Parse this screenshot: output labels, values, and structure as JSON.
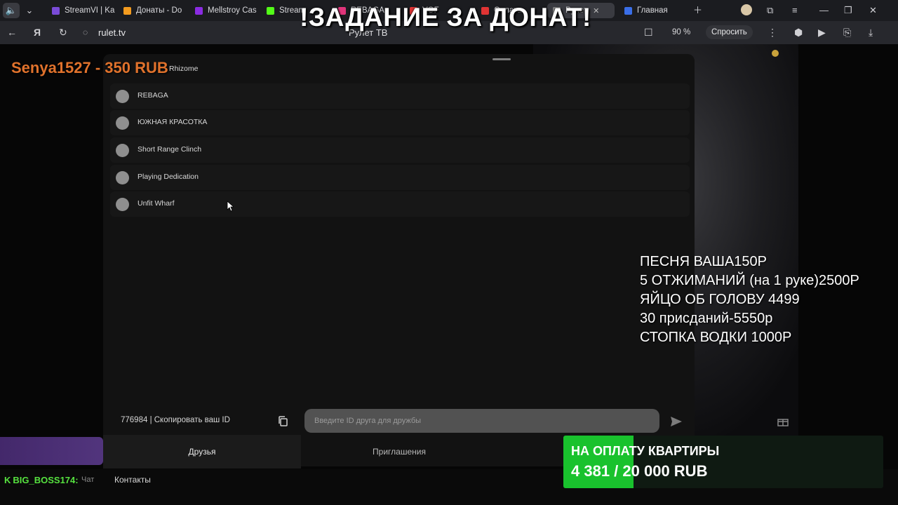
{
  "browser": {
    "tabs": [
      {
        "label": "StreamVI | Ka",
        "color": "#7a4bd8"
      },
      {
        "label": "Донаты - Do",
        "color": "#f39b1f"
      },
      {
        "label": "Mellstroy Cas",
        "color": "#8a2be2"
      },
      {
        "label": "Stream",
        "color": "#53fc18"
      },
      {
        "label": "REBAGA",
        "color": "#e0347a"
      },
      {
        "label": "VOF",
        "color": "#e03434"
      },
      {
        "label": "Оплата",
        "color": "#e03434"
      },
      {
        "label": "Рулет",
        "color": "#888888"
      },
      {
        "label": "Главная",
        "color": "#3a6ee8"
      }
    ],
    "url": "rulet.tv",
    "page_title": "Рулет ТВ",
    "zoom": "90 %",
    "ask_label": "Спросить"
  },
  "overlay": {
    "headline": "!ЗАДАНИЕ ЗА ДОНАТ!",
    "donor": "Senya1527 - 350 RUB",
    "price_list": [
      "ПЕСНЯ ВАША150Р",
      "5 ОТЖИМАНИЙ (на 1 руке)2500Р",
      "ЯЙЦО ОБ ГОЛОВУ 4499",
      "30 присданий-5550р",
      "СТОПКА ВОДКИ 1000Р"
    ],
    "goal": {
      "title": "НА ОПЛАТУ КВАРТИРЫ",
      "amount_text": "4 381 / 20 000 RUB",
      "current": 4381,
      "target": 20000
    },
    "chatter": "BIG_BOSS174:"
  },
  "friends_panel": {
    "friends": [
      "Rhizome",
      "REBAGA",
      "ЮЖНАЯ КРАСОТКА",
      "Short Range Clinch",
      "Playing Dedication",
      "Unfit Wharf"
    ],
    "id_text": "776984  |  Скопировать ваш ID",
    "friend_input_placeholder": "Введите ID друга для дружбы",
    "tabs": {
      "friends": "Друзья",
      "invites": "Приглашения"
    }
  },
  "bottom_nav": {
    "chat": "Чат",
    "contacts": "Контакты"
  }
}
